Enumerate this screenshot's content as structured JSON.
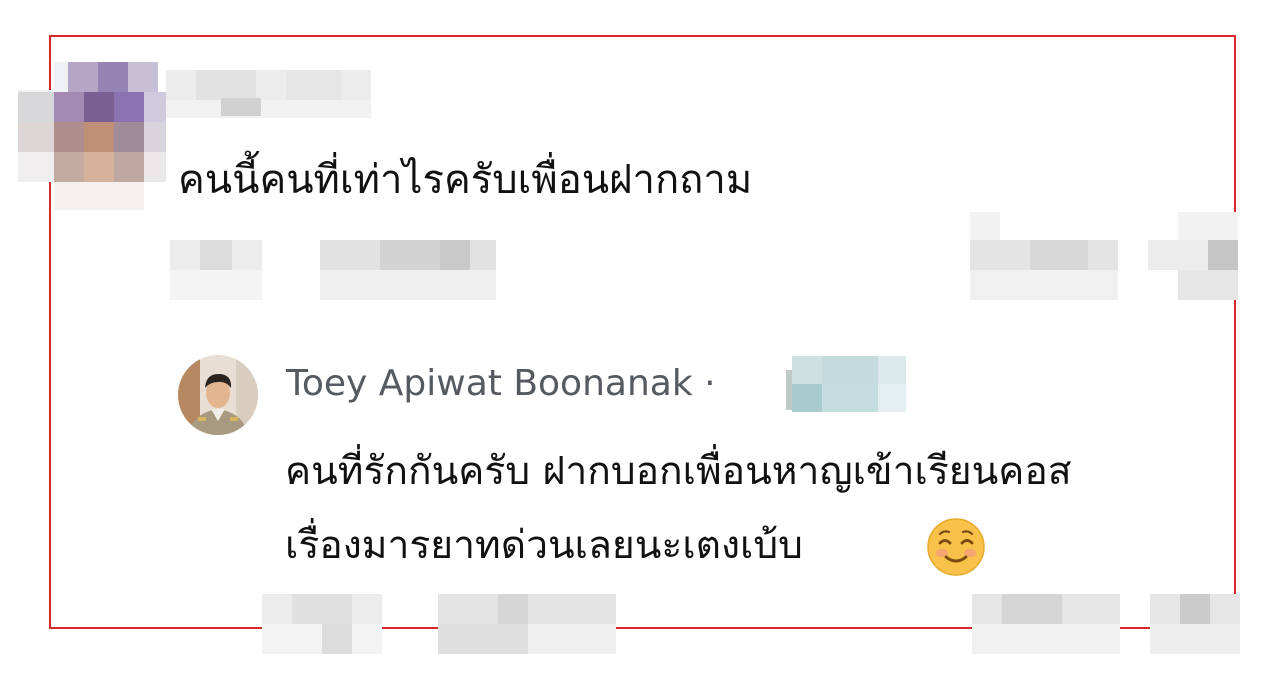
{
  "comment": {
    "text": "คนนี้คนที่เท่าไรครับเพื่อนฝากถาม"
  },
  "reply": {
    "author": "Toey Apiwat Boonanak",
    "separator": "·",
    "line1": "คนที่รักกันครับ ฝากบอกเพื่อนหาญเข้าเรียนคอส",
    "line2": "เรื่องมารยาทด่วนเลยนะเตงเบ้บ"
  },
  "icons": {
    "reply_emoji": "smiling-face-emoji",
    "avatar": "user-avatar-photo"
  },
  "colors": {
    "highlight_border": "#d9262c",
    "name_text": "#555a60"
  }
}
